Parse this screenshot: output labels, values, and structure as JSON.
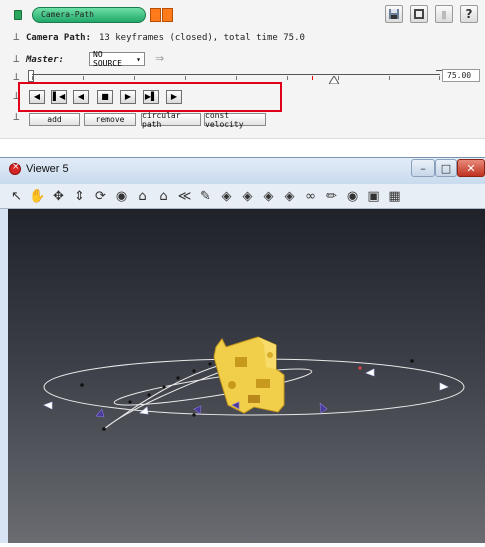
{
  "panel": {
    "node_label": "Camera-Path",
    "camera_path_label": "Camera Path:",
    "camera_path_info": "13 keyframes (closed), total time 75.0",
    "master_label": "Master:",
    "master_value": "NO SOURCE",
    "time_value": "75.00",
    "buttons": {
      "add": "add",
      "remove": "remove",
      "circular": "circular path",
      "const_velocity": "const velocity"
    },
    "playback_icons": [
      "rewind-icon",
      "skip-start-icon",
      "step-back-icon",
      "stop-icon",
      "play-icon",
      "skip-end-icon",
      "forward-icon"
    ],
    "highlight_color": "#e0001a"
  },
  "viewer": {
    "title": "Viewer 5",
    "accent": "#d62525",
    "model_color": "#f2cf4a",
    "toolbar_icons": [
      "pointer-icon",
      "hand-icon",
      "move-icon",
      "dolly-icon",
      "rotate-icon",
      "zoom-icon",
      "home-icon",
      "set-home-icon",
      "seek-icon",
      "pick-icon",
      "view-x-icon",
      "view-y-icon",
      "view-z-icon",
      "view-xz-icon",
      "stereo-icon",
      "measure-icon",
      "snapshot-icon",
      "fullscreen-icon",
      "layout-icon"
    ]
  }
}
